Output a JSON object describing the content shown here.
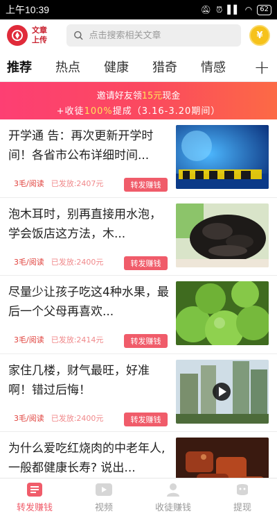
{
  "status_bar": {
    "time": "上午10:39",
    "battery": "62"
  },
  "header": {
    "logo_line1": "文章",
    "logo_line2": "上传",
    "search_placeholder": "点击搜索相关文章",
    "coin_label": "¥"
  },
  "tabs": [
    "推荐",
    "热点",
    "健康",
    "猎奇",
    "情感"
  ],
  "tab_plus": "+",
  "banner": {
    "line1_prefix": "邀请好友领",
    "line1_highlight": "15元",
    "line1_suffix": "现金",
    "line2_prefix": "+收徒",
    "line2_highlight": "100%",
    "line2_suffix": "提成（3.16-3.20期间）"
  },
  "articles": [
    {
      "title": "开学通 告：再次更新开学时间！各省市公布详细时间...",
      "price": "3毛/阅读",
      "sent": "已发放:2407元",
      "action": "转发赚钱",
      "thumb": "blue-sign-image"
    },
    {
      "title": "泡木耳时，别再直接用水泡，学会饭店这方法，木...",
      "price": "3毛/阅读",
      "sent": "已发放:2400元",
      "action": "转发赚钱",
      "thumb": "black-fungus-image"
    },
    {
      "title": "尽量少让孩子吃这4种水果，最后一个父母再喜欢...",
      "price": "3毛/阅读",
      "sent": "已发放:2414元",
      "action": "转发赚钱",
      "thumb": "green-fruit-image"
    },
    {
      "title": "家住几楼，财气最旺，好准啊！错过后悔！",
      "price": "3毛/阅读",
      "sent": "已发放:2400元",
      "action": "转发赚钱",
      "thumb": "buildings-video-image"
    },
    {
      "title": "为什么爱吃红烧肉的中老年人,一般都健康长寿? 说出...",
      "price": "",
      "sent": "",
      "action": "",
      "thumb": "braised-pork-image"
    }
  ],
  "bottom_nav": [
    {
      "label": "转发赚钱",
      "icon": "share-earn-icon",
      "active": true
    },
    {
      "label": "视频",
      "icon": "video-icon",
      "active": false
    },
    {
      "label": "收徒赚钱",
      "icon": "person-icon",
      "active": false
    },
    {
      "label": "提现",
      "icon": "withdraw-icon",
      "active": false
    }
  ],
  "colors": {
    "accent": "#f05c6a",
    "brand_red": "#e02b3a",
    "banner_start": "#fd3f73",
    "banner_end": "#fc6a45"
  }
}
